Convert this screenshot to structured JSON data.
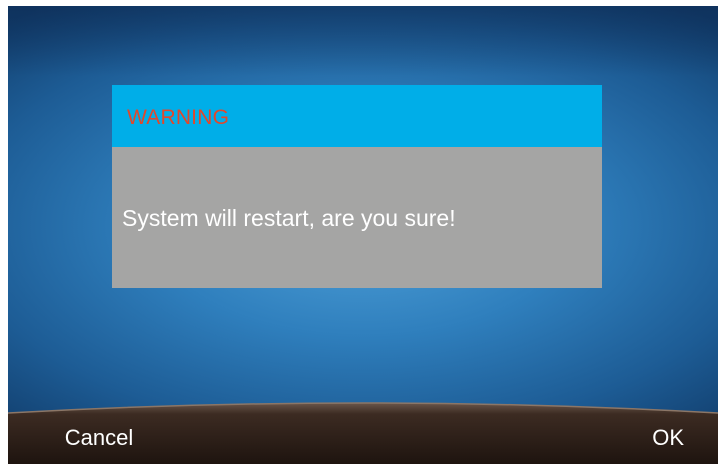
{
  "dialog": {
    "title": "WARNING",
    "message": "System will restart, are you sure!",
    "header_color": "#00aee8",
    "title_color": "#e0482c",
    "body_color": "#a5a5a4"
  },
  "softkeys": [
    {
      "label": "Cancel"
    },
    {
      "label": ""
    },
    {
      "label": ""
    },
    {
      "label": "OK"
    }
  ],
  "colors": {
    "screen_background": "#2f7fbd",
    "softkey_bar": "#2a1d16"
  }
}
